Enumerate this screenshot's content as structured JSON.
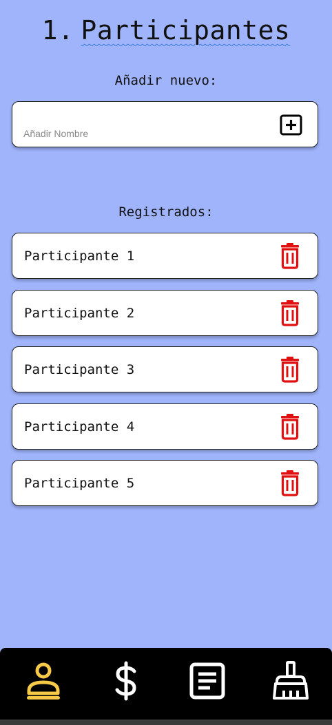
{
  "header": {
    "number": "1.",
    "title": "Participantes"
  },
  "add_section": {
    "label": "Añadir nuevo:",
    "placeholder": "Añadir Nombre",
    "add_icon": "plus-square-icon"
  },
  "registered_section": {
    "label": "Registrados:",
    "items": [
      {
        "name": "Participante 1"
      },
      {
        "name": "Participante 2"
      },
      {
        "name": "Participante 3"
      },
      {
        "name": "Participante 4"
      },
      {
        "name": "Participante 5"
      }
    ],
    "delete_icon": "trash-icon"
  },
  "nav": {
    "items": [
      {
        "icon": "person-icon",
        "active": true
      },
      {
        "icon": "dollar-icon",
        "active": false
      },
      {
        "icon": "document-icon",
        "active": false
      },
      {
        "icon": "broom-icon",
        "active": false
      }
    ]
  },
  "colors": {
    "background": "#a0b4fc",
    "delete": "#e01010",
    "nav_active": "#f7c948",
    "nav_inactive": "#ffffff",
    "nav_bar": "#000000"
  }
}
